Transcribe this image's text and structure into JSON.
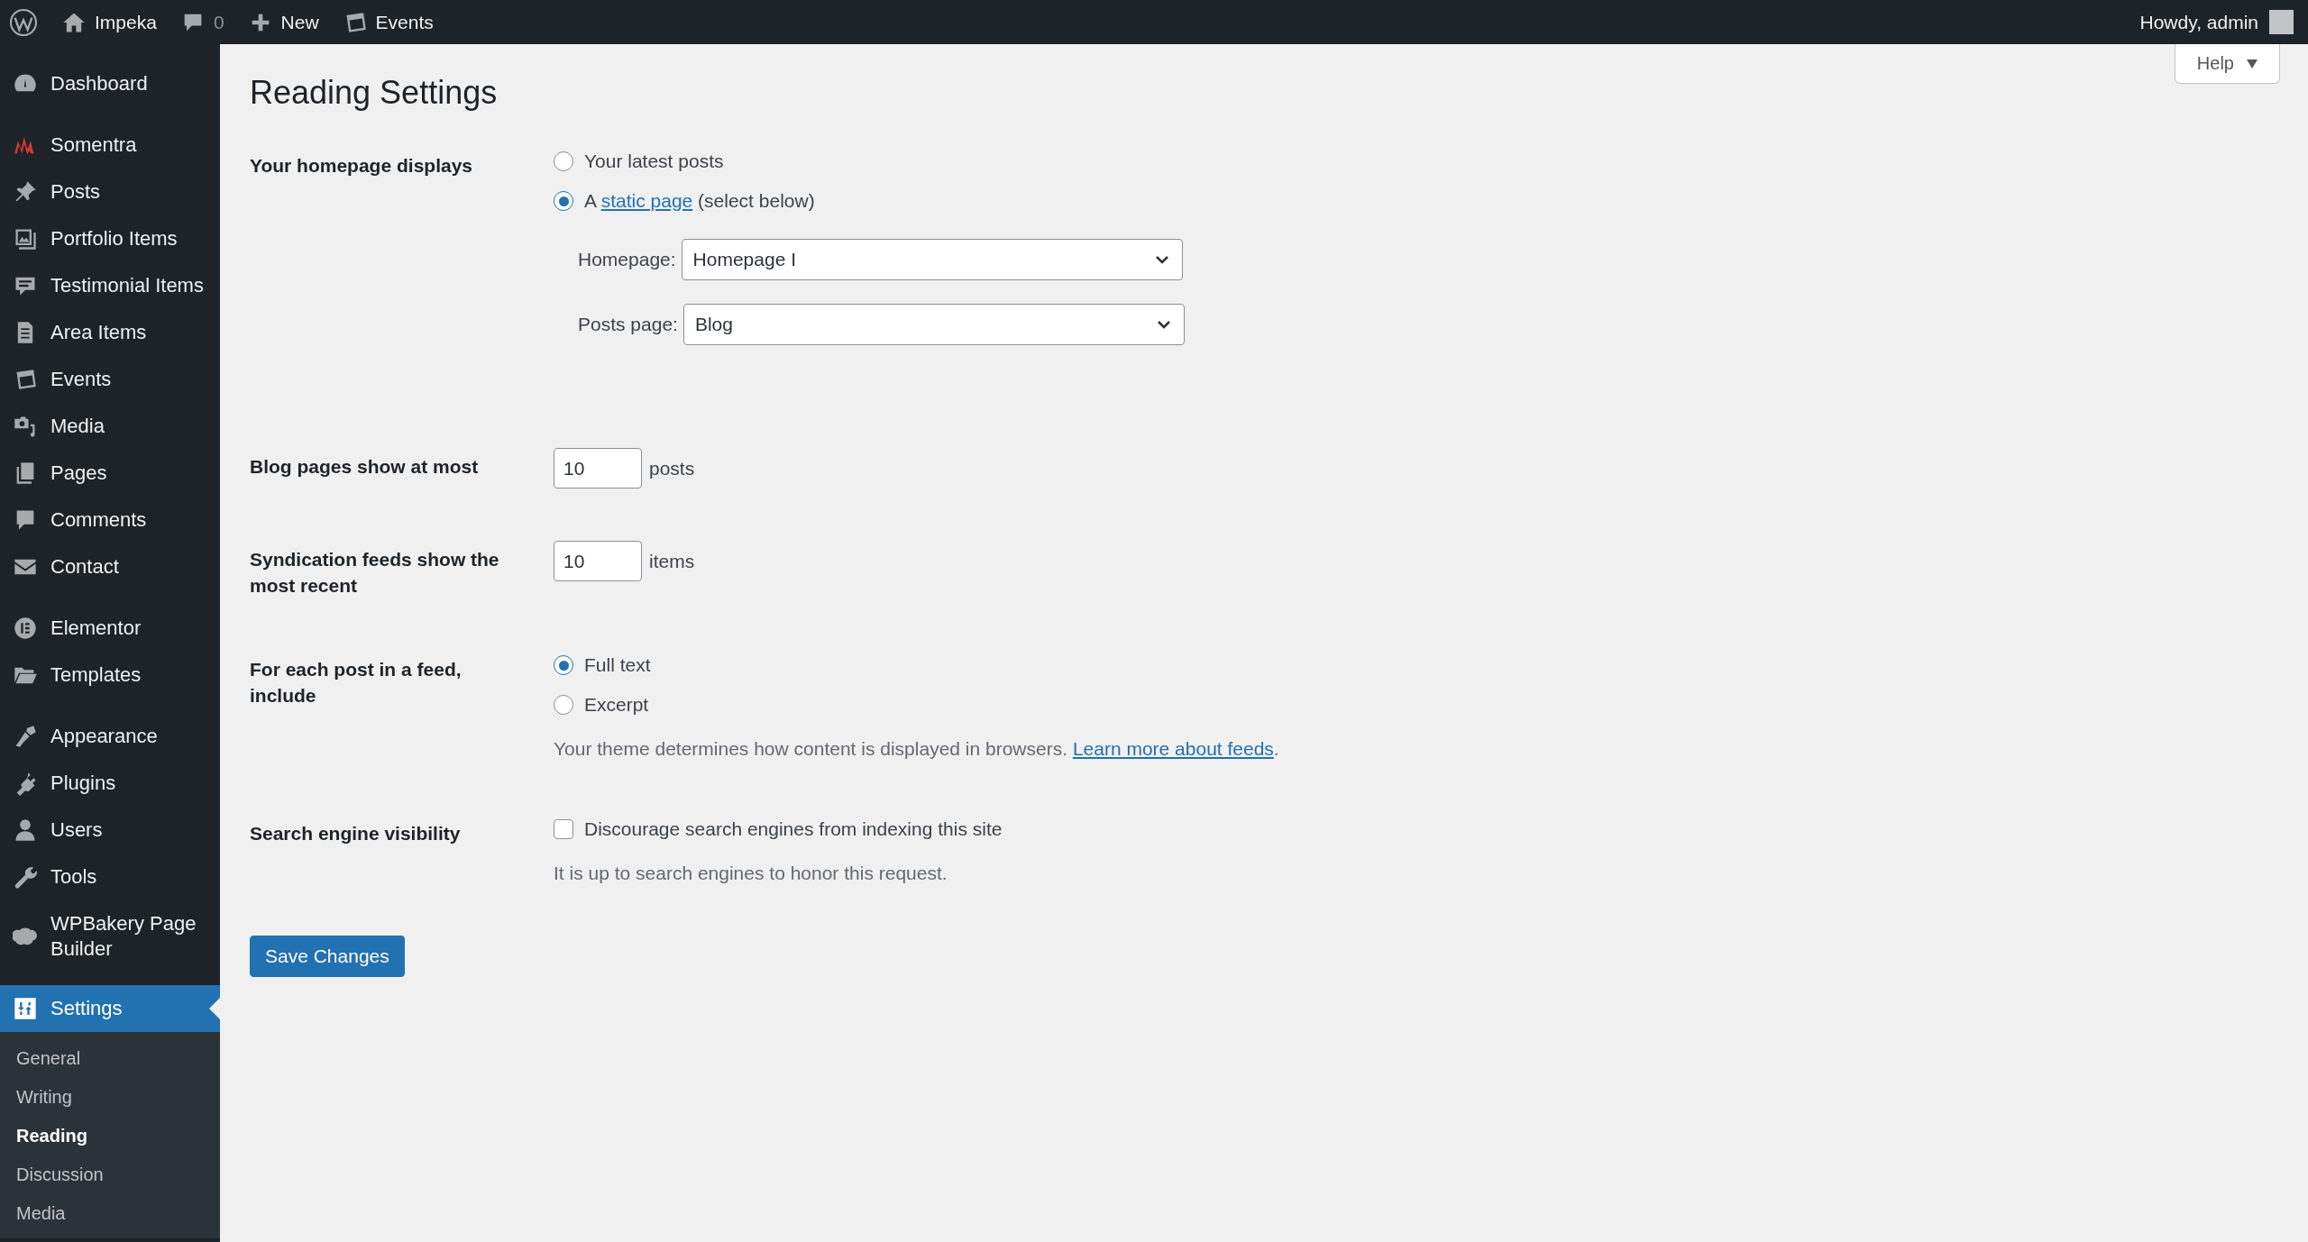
{
  "admin_bar": {
    "items": [
      {
        "kind": "logo"
      },
      {
        "kind": "site",
        "label": "Impeka"
      },
      {
        "kind": "comments",
        "label": "0"
      },
      {
        "kind": "new",
        "label": "New"
      },
      {
        "kind": "events",
        "label": "Events"
      }
    ],
    "account": "Howdy, admin"
  },
  "sidebar": {
    "groups": [
      [
        {
          "kind": "dashboard",
          "label": "Dashboard",
          "selected": false
        }
      ],
      [
        {
          "kind": "zigzag",
          "label": "Somentra",
          "selected": false
        },
        {
          "kind": "pin",
          "label": "Posts",
          "selected": false
        },
        {
          "kind": "portfolio",
          "label": "Portfolio Items",
          "selected": false
        },
        {
          "kind": "testimonial",
          "label": "Testimonial Items",
          "selected": false
        },
        {
          "kind": "document",
          "label": "Area Items",
          "selected": false
        },
        {
          "kind": "calendar",
          "label": "Events",
          "selected": false
        },
        {
          "kind": "media",
          "label": "Media",
          "selected": false
        },
        {
          "kind": "pages",
          "label": "Pages",
          "selected": false
        },
        {
          "kind": "comment",
          "label": "Comments",
          "selected": false
        },
        {
          "kind": "mail",
          "label": "Contact",
          "selected": false
        }
      ],
      [
        {
          "kind": "elementor",
          "label": "Elementor",
          "selected": false
        },
        {
          "kind": "folder",
          "label": "Templates",
          "selected": false
        }
      ],
      [
        {
          "kind": "brush",
          "label": "Appearance",
          "selected": false
        },
        {
          "kind": "plug",
          "label": "Plugins",
          "selected": false
        },
        {
          "kind": "user",
          "label": "Users",
          "selected": false
        },
        {
          "kind": "wrench",
          "label": "Tools",
          "selected": false
        },
        {
          "kind": "cloud",
          "label": "WPBakery Page Builder",
          "selected": false
        },
        {
          "kind": "sliders",
          "label": "Settings",
          "selected": true,
          "submenu": [
            {
              "label": "General",
              "selected": false
            },
            {
              "label": "Writing",
              "selected": false
            },
            {
              "label": "Reading",
              "selected": true
            },
            {
              "label": "Discussion",
              "selected": false
            },
            {
              "label": "Media",
              "selected": false
            }
          ]
        }
      ]
    ]
  },
  "help_button": "Help",
  "page_title": "Reading Settings",
  "form": {
    "rows": [
      {
        "kind": "radios",
        "label": "Your homepage displays",
        "options": [
          {
            "label": "Your latest posts",
            "selected": false
          },
          {
            "before": "A",
            "link": "static page",
            "after": "(select below)",
            "selected": true
          }
        ],
        "selects": [
          {
            "label": "Homepage:",
            "value": "Homepage I"
          },
          {
            "label": "Posts page:",
            "value": "Blog"
          }
        ]
      },
      {
        "kind": "number",
        "label": "Blog pages show at most",
        "value": "10",
        "unit": "posts"
      },
      {
        "kind": "number",
        "label": "Syndication feeds show the most recent",
        "value": "10",
        "unit": "items"
      },
      {
        "kind": "radios",
        "label": "For each post in a feed, include",
        "options": [
          {
            "label": "Full text",
            "selected": true
          },
          {
            "label": "Excerpt",
            "selected": false
          }
        ],
        "description": {
          "text": "Your theme determines how content is displayed in browsers.",
          "link": "Learn more about feeds",
          "after": "."
        }
      },
      {
        "kind": "checkbox",
        "label": "Search engine visibility",
        "option": {
          "label": "Discourage search engines from indexing this site",
          "checked": false
        },
        "description": {
          "text": "It is up to search engines to honor this request."
        }
      }
    ],
    "submit": "Save Changes"
  }
}
